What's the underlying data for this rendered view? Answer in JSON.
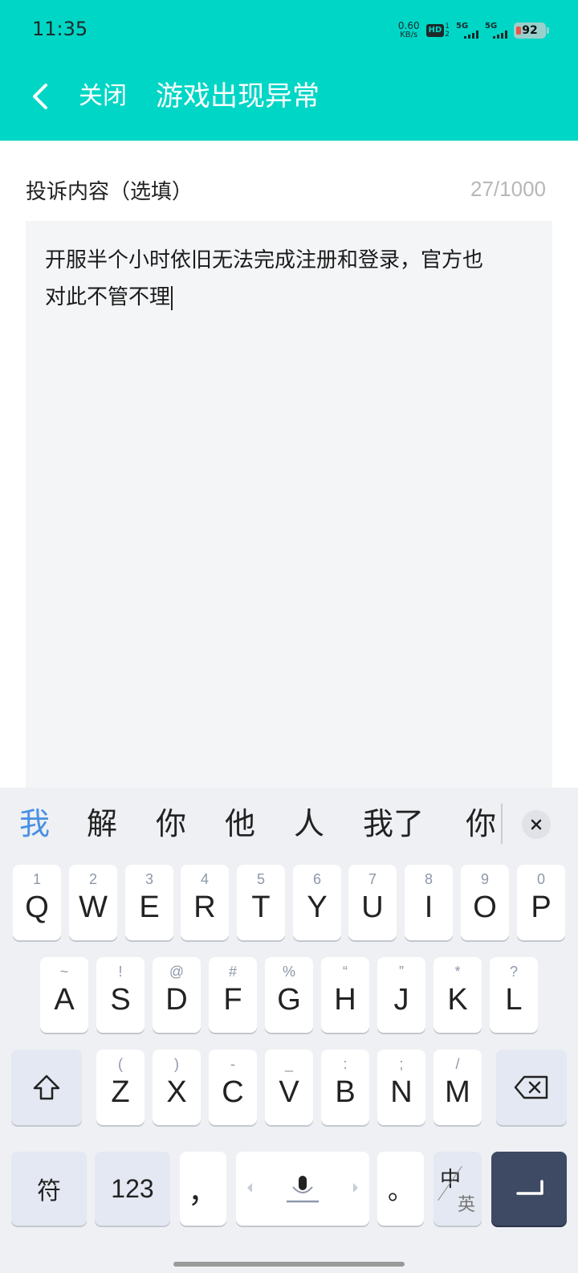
{
  "status_bar": {
    "time": "11:35",
    "net_speed_value": "0.60",
    "net_speed_unit": "KB/s",
    "hd_label": "HD",
    "hd_sim1": "1",
    "hd_sim2": "2",
    "signal1_label": "5G",
    "signal2_label": "5G",
    "battery": "92"
  },
  "header": {
    "close_label": "关闭",
    "title": "游戏出现异常",
    "bg_color": "#00d6c6"
  },
  "form": {
    "label": "投诉内容（选填）",
    "char_count": "27/1000",
    "content_line1": "开服半个小时依旧无法完成注册和登录，官方也",
    "content_line2": "对此不管不理"
  },
  "keyboard": {
    "candidates": [
      "我",
      "解",
      "你",
      "他",
      "人",
      "我了",
      "你"
    ],
    "row1": [
      {
        "hint": "1",
        "key": "Q"
      },
      {
        "hint": "2",
        "key": "W"
      },
      {
        "hint": "3",
        "key": "E"
      },
      {
        "hint": "4",
        "key": "R"
      },
      {
        "hint": "5",
        "key": "T"
      },
      {
        "hint": "6",
        "key": "Y"
      },
      {
        "hint": "7",
        "key": "U"
      },
      {
        "hint": "8",
        "key": "I"
      },
      {
        "hint": "9",
        "key": "O"
      },
      {
        "hint": "0",
        "key": "P"
      }
    ],
    "row2": [
      {
        "hint": "~",
        "key": "A"
      },
      {
        "hint": "!",
        "key": "S"
      },
      {
        "hint": "@",
        "key": "D"
      },
      {
        "hint": "#",
        "key": "F"
      },
      {
        "hint": "%",
        "key": "G"
      },
      {
        "hint": "“",
        "key": "H"
      },
      {
        "hint": "”",
        "key": "J"
      },
      {
        "hint": "*",
        "key": "K"
      },
      {
        "hint": "?",
        "key": "L"
      }
    ],
    "row3": [
      {
        "hint": "(",
        "key": "Z"
      },
      {
        "hint": ")",
        "key": "X"
      },
      {
        "hint": "-",
        "key": "C"
      },
      {
        "hint": "_",
        "key": "V"
      },
      {
        "hint": ":",
        "key": "B"
      },
      {
        "hint": ";",
        "key": "N"
      },
      {
        "hint": "/",
        "key": "M"
      }
    ],
    "symbols_key": "符",
    "numbers_key": "123",
    "comma_key": "，",
    "period_key": "。",
    "lang_zh": "中",
    "lang_en": "英",
    "accent_color": "#4a90e2",
    "enter_color": "#3e4a64"
  }
}
